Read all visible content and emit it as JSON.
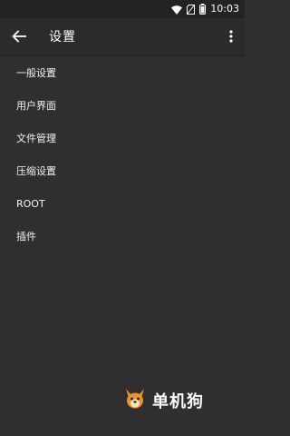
{
  "status_bar": {
    "time": "10:03",
    "icons": [
      "wifi-icon",
      "sim-off-icon",
      "battery-icon"
    ]
  },
  "app_bar": {
    "back_icon": "arrow-left-icon",
    "title": "设置",
    "overflow_icon": "more-vert-icon"
  },
  "menu": {
    "items": [
      {
        "label": "一般设置"
      },
      {
        "label": "用户界面"
      },
      {
        "label": "文件管理"
      },
      {
        "label": "压缩设置"
      },
      {
        "label": "ROOT"
      },
      {
        "label": "插件"
      }
    ]
  },
  "watermark": {
    "logo_icon": "dog-logo-icon",
    "text": "单机狗"
  },
  "colors": {
    "background": "#2f2f2f",
    "app_bar": "#2b2b2b",
    "status_bar": "#232323",
    "text": "#ffffff",
    "logo_orange": "#e8942a"
  }
}
